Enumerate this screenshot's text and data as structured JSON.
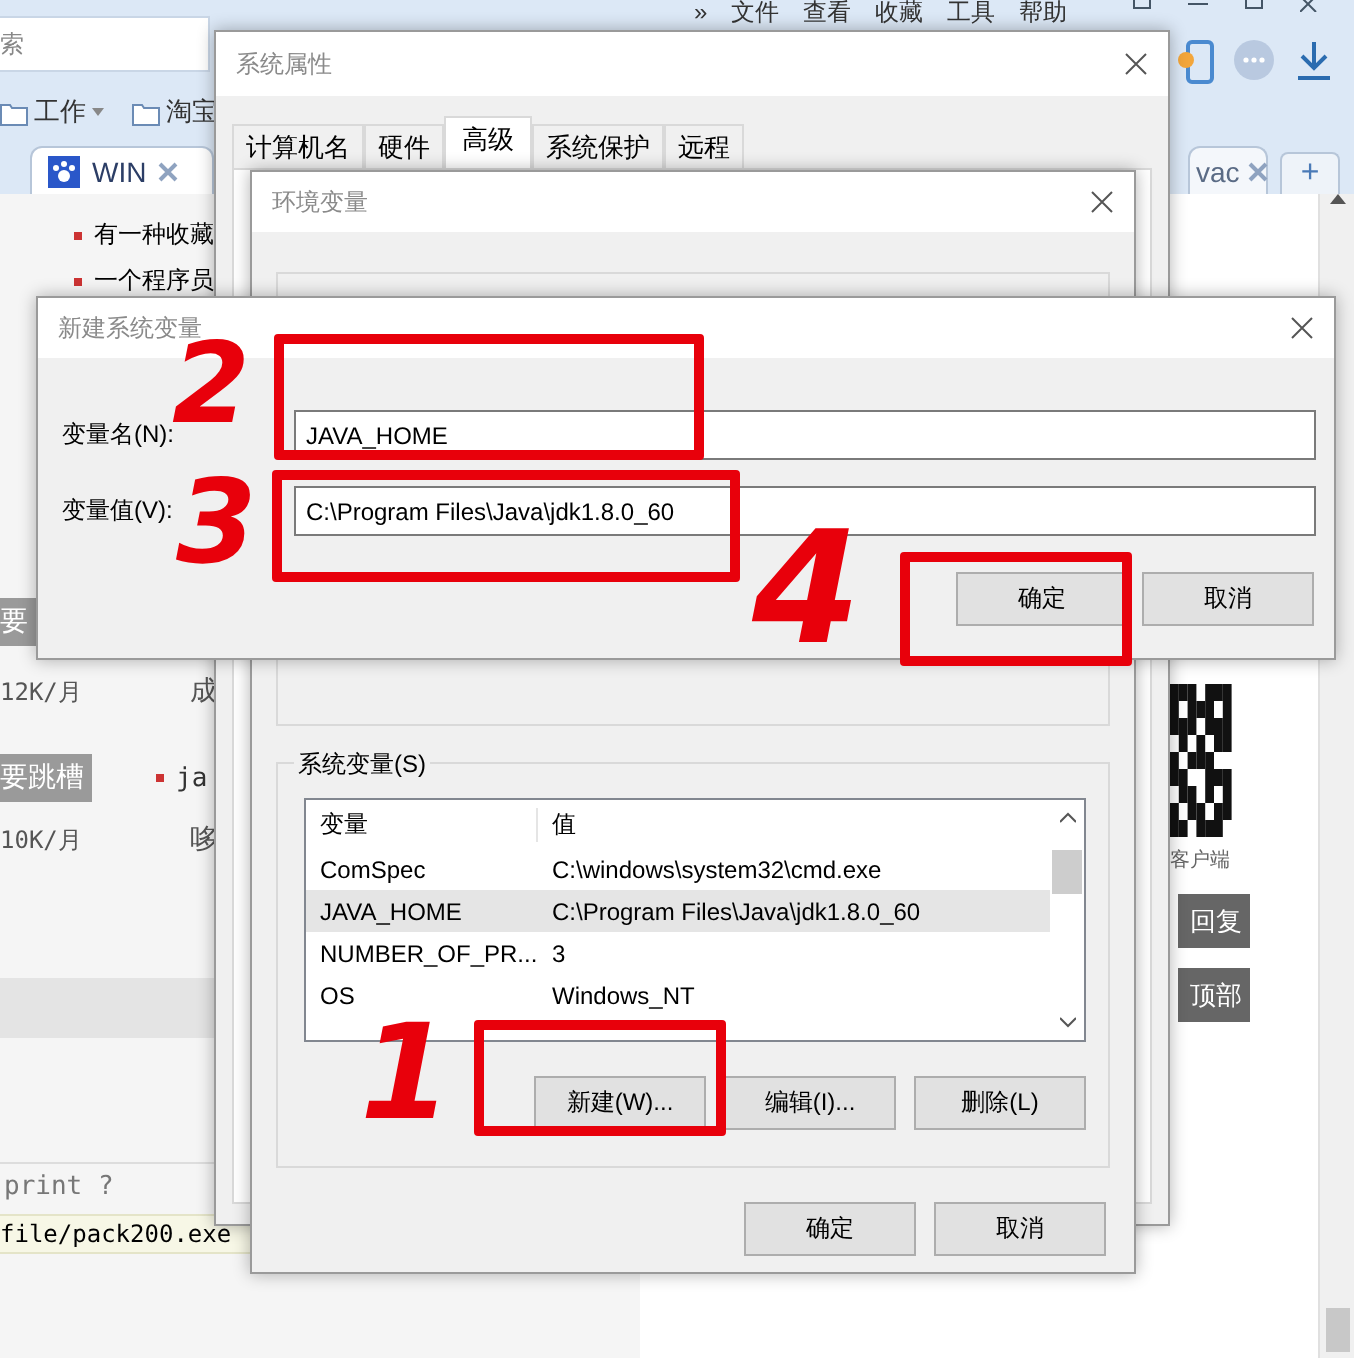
{
  "browser": {
    "menu": [
      "»",
      "文件",
      "查看",
      "收藏",
      "工具",
      "帮助"
    ],
    "address": "索",
    "bookmarks": [
      "工作",
      "淘宝"
    ],
    "tabs": [
      {
        "label": "WIN",
        "selected": true
      },
      {
        "label": "vac",
        "selected": false
      }
    ],
    "new_tab": "+",
    "content": {
      "bullets": [
        "有一种收藏",
        "一个程序员"
      ],
      "jobs": [
        {
          "tag": "要",
          "salary": "12K/月",
          "note": "成"
        },
        {
          "tag": "要跳槽",
          "bullet": "ja",
          "salary": "10K/月",
          "note": "哆"
        }
      ],
      "code_header": "print ?",
      "code_line": "file/pack200.exe"
    },
    "sidebar": {
      "qr_caption": "客户端",
      "buttons": [
        "回复",
        "顶部"
      ]
    }
  },
  "system_properties": {
    "title": "系统属性",
    "tabs": [
      {
        "label": "计算机名",
        "selected": false
      },
      {
        "label": "硬件",
        "selected": false
      },
      {
        "label": "高级",
        "selected": true
      },
      {
        "label": "系统保护",
        "selected": false
      },
      {
        "label": "远程",
        "selected": false
      }
    ]
  },
  "environment_variables": {
    "title": "环境变量",
    "system_variables": {
      "label": "系统变量(S)",
      "columns": [
        "变量",
        "值"
      ],
      "rows": [
        {
          "name": "ComSpec",
          "value": "C:\\windows\\system32\\cmd.exe",
          "selected": false
        },
        {
          "name": "JAVA_HOME",
          "value": "C:\\Program Files\\Java\\jdk1.8.0_60",
          "selected": true
        },
        {
          "name": "NUMBER_OF_PR...",
          "value": "3",
          "selected": false
        },
        {
          "name": "OS",
          "value": "Windows_NT",
          "selected": false
        }
      ],
      "buttons": [
        "新建(W)...",
        "编辑(I)...",
        "删除(L)"
      ]
    },
    "buttons": [
      "确定",
      "取消"
    ]
  },
  "new_system_variable": {
    "title": "新建系统变量",
    "fields": [
      {
        "label": "变量名(N):",
        "value": "JAVA_HOME"
      },
      {
        "label": "变量值(V):",
        "value": "C:\\Program Files\\Java\\jdk1.8.0_60"
      }
    ],
    "buttons": [
      "确定",
      "取消"
    ]
  },
  "annotations": [
    {
      "label": "2"
    },
    {
      "label": "3"
    },
    {
      "label": "4"
    },
    {
      "label": "1"
    }
  ]
}
